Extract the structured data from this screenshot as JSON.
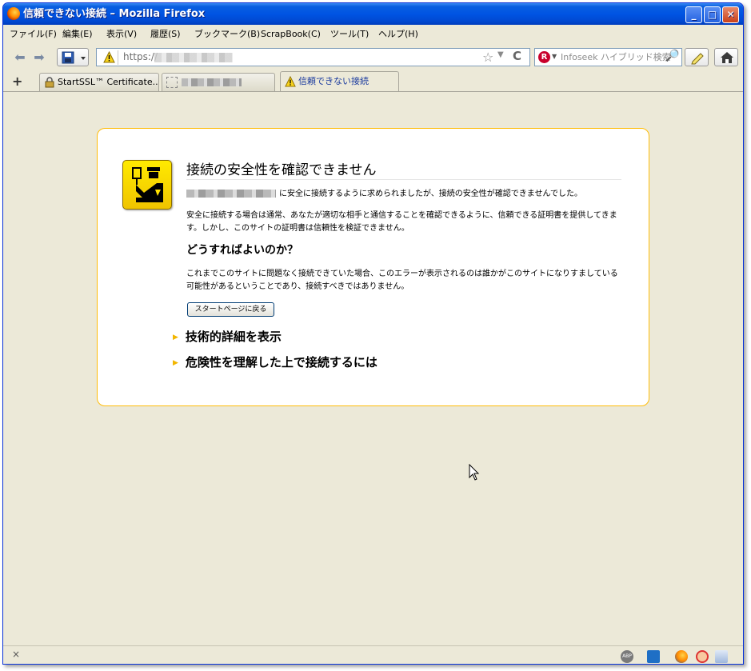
{
  "window": {
    "title": "信頼できない接続 – Mozilla Firefox"
  },
  "menu": [
    "ファイル(F)",
    "編集(E)",
    "表示(V)",
    "履歴(S)",
    "ブックマーク(B)",
    "ScrapBook(C)",
    "ツール(T)",
    "ヘルプ(H)"
  ],
  "urlbar": {
    "url": "https://"
  },
  "searchbar": {
    "placeholder": "Infoseek ハイブリッド検索"
  },
  "tabs": [
    {
      "label": "StartSSL™ Certificate...",
      "active": false
    },
    {
      "label": "",
      "active": false
    },
    {
      "label": "信頼できない接続",
      "active": true
    }
  ],
  "error": {
    "title": "接続の安全性を確認できません",
    "p1": "に安全に接続するように求められましたが、接続の安全性が確認できませんでした。",
    "p2": "安全に接続する場合は通常、あなたが適切な相手と通信することを確認できるように、信頼できる証明書を提供してきます。しかし、このサイトの証明書は信頼性を検証できません。",
    "subheading": "どうすればよいのか？",
    "p3": "これまでこのサイトに問題なく接続できていた場合、このエラーが表示されるのは誰かがこのサイトになりすましている可能性があるということであり、接続すべきではありません。",
    "button": "スタートページに戻る",
    "expander1": "技術的詳細を表示",
    "expander2": "危険性を理解した上で接続するには"
  },
  "statusbar": {
    "close": "×"
  },
  "colors": {
    "error_border": "#ffbd09",
    "titlebar": "#0054e3",
    "chrome": "#ece9d8"
  }
}
